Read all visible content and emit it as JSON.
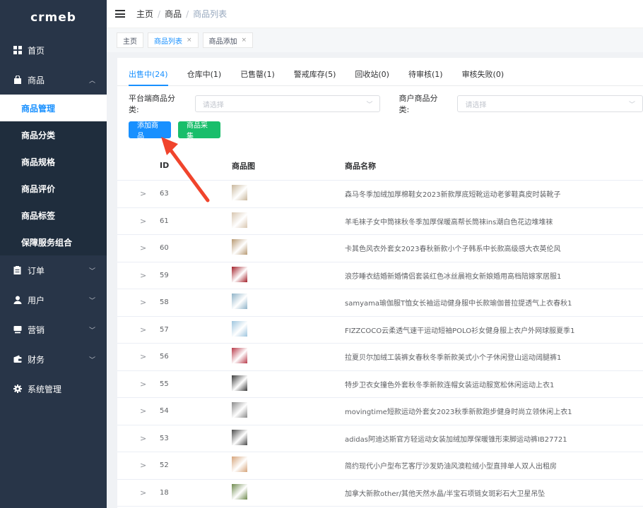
{
  "logo": "crmeb",
  "sidebar": {
    "items": [
      {
        "label": "首页",
        "icon": "grid-icon"
      },
      {
        "label": "商品",
        "icon": "bag-icon",
        "expanded": true,
        "children": [
          "商品管理",
          "商品分类",
          "商品规格",
          "商品评价",
          "商品标签",
          "保障服务组合"
        ]
      },
      {
        "label": "订单",
        "icon": "order-icon"
      },
      {
        "label": "用户",
        "icon": "user-icon"
      },
      {
        "label": "营销",
        "icon": "marketing-icon"
      },
      {
        "label": "财务",
        "icon": "finance-icon"
      },
      {
        "label": "系统管理",
        "icon": "gear-icon"
      }
    ]
  },
  "breadcrumb": [
    "主页",
    "商品",
    "商品列表"
  ],
  "tags": [
    {
      "label": "主页",
      "closable": false
    },
    {
      "label": "商品列表",
      "closable": true,
      "active": true
    },
    {
      "label": "商品添加",
      "closable": true
    }
  ],
  "tabs": [
    "出售中(24)",
    "仓库中(1)",
    "已售罄(1)",
    "警戒库存(5)",
    "回收站(0)",
    "待审核(1)",
    "审核失败(0)"
  ],
  "filters": {
    "platform_label": "平台端商品分类:",
    "platform_placeholder": "请选择",
    "merchant_label": "商户商品分类:",
    "merchant_placeholder": "请选择"
  },
  "buttons": {
    "add": "添加商品",
    "collect": "商品采集"
  },
  "table": {
    "headers": [
      "ID",
      "商品图",
      "商品名称"
    ],
    "rows": [
      {
        "id": "63",
        "name": "森马冬季加绒加厚棉鞋女2023新款厚底短靴运动老爹鞋真皮时装靴子",
        "color": "#c9b79c"
      },
      {
        "id": "61",
        "name": "羊毛袜子女中筒袜秋冬季加厚保暖高帮长筒袜ins潮白色花边堆堆袜",
        "color": "#d8c6b0"
      },
      {
        "id": "60",
        "name": "卡其色风衣外套女2023春秋新款小个子韩系中长款高级感大衣英伦风",
        "color": "#b89a73"
      },
      {
        "id": "59",
        "name": "浪莎睡衣结婚新婚情侣套装红色冰丝晨袍女新娘婚用高档陪嫁家居服1",
        "color": "#a3202a"
      },
      {
        "id": "58",
        "name": "samyama瑜伽服T恤女长袖运动健身服中长款瑜伽普拉提透气上衣春秋1",
        "color": "#8fb3c8"
      },
      {
        "id": "57",
        "name": "FIZZCOCO云柔透气速干运动短袖POLO衫女健身服上衣户外网球服夏季1",
        "color": "#9ec5de"
      },
      {
        "id": "56",
        "name": "拉夏贝尔加绒工装裤女春秋冬季新款美式小个子休闲登山运动阔腿裤1",
        "color": "#b83a4a"
      },
      {
        "id": "55",
        "name": "特步卫衣女撞色外套秋冬季新款连帽女装运动服宽松休闲运动上衣1",
        "color": "#3a3a3a"
      },
      {
        "id": "54",
        "name": "movingtime短款运动外套女2023秋季新款跑步健身时尚立领休闲上衣1",
        "color": "#8a8a8a"
      },
      {
        "id": "53",
        "name": "adidas阿迪达斯官方轻运动女装加绒加厚保暖锥形束脚运动裤IB27721",
        "color": "#4a4a4a"
      },
      {
        "id": "52",
        "name": "简约现代小户型布艺客厅沙发奶油风澳粒绒小型直排单人双人出租房",
        "color": "#d6a47a"
      },
      {
        "id": "18",
        "name": "加拿大新款other/其他天然水晶/半宝石项链女斑彩石大卫星吊坠",
        "color": "#6f8a4e"
      }
    ]
  },
  "colors": {
    "sidebar": "#283548",
    "accent": "#1890ff",
    "green": "#19be6b",
    "arrow": "#f0442c"
  }
}
